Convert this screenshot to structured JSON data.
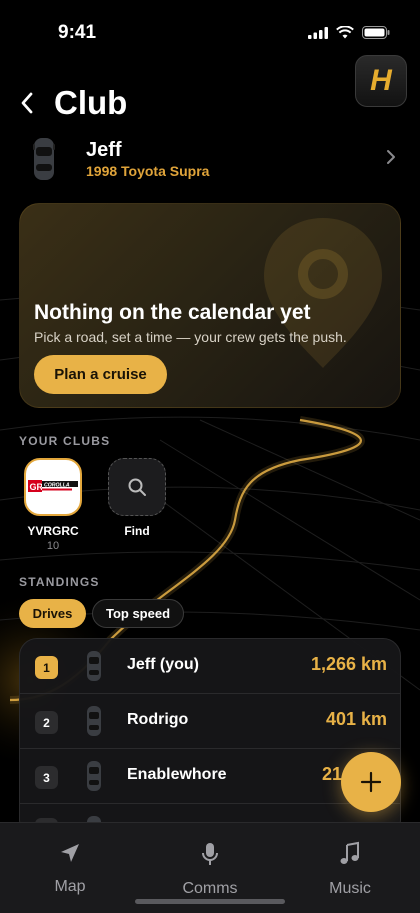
{
  "status_bar": {
    "time": "9:41"
  },
  "app": {
    "logo_letter": "H"
  },
  "header": {
    "title": "Club"
  },
  "driver": {
    "name": "Jeff",
    "car": "1998 Toyota Supra"
  },
  "calendar_card": {
    "title": "Nothing on the calendar yet",
    "subtitle": "Pick a road, set a time — your crew gets the push.",
    "button_label": "Plan a cruise"
  },
  "clubs": {
    "section_label": "YOUR CLUBS",
    "items": [
      {
        "name": "YVRGRC",
        "members": "10",
        "logo_text": "COROLLA"
      },
      {
        "name": "Find"
      }
    ]
  },
  "standings": {
    "section_label": "STANDINGS",
    "filters": [
      {
        "label": "Drives",
        "active": true
      },
      {
        "label": "Top speed",
        "active": false
      }
    ],
    "rows": [
      {
        "rank": "1",
        "name": "Jeff (you)",
        "distance": "1,266 km"
      },
      {
        "rank": "2",
        "name": "Rodrigo",
        "distance": "401 km"
      },
      {
        "rank": "3",
        "name": "Enablewhore",
        "distance": "21"
      }
    ]
  },
  "tabbar": {
    "items": [
      {
        "label": "Map",
        "icon": "navigation-arrow-icon"
      },
      {
        "label": "Comms",
        "icon": "microphone-icon"
      },
      {
        "label": "Music",
        "icon": "music-note-icon"
      }
    ]
  },
  "colors": {
    "accent": "#e8b247",
    "background": "#000000",
    "card": "#161618"
  }
}
